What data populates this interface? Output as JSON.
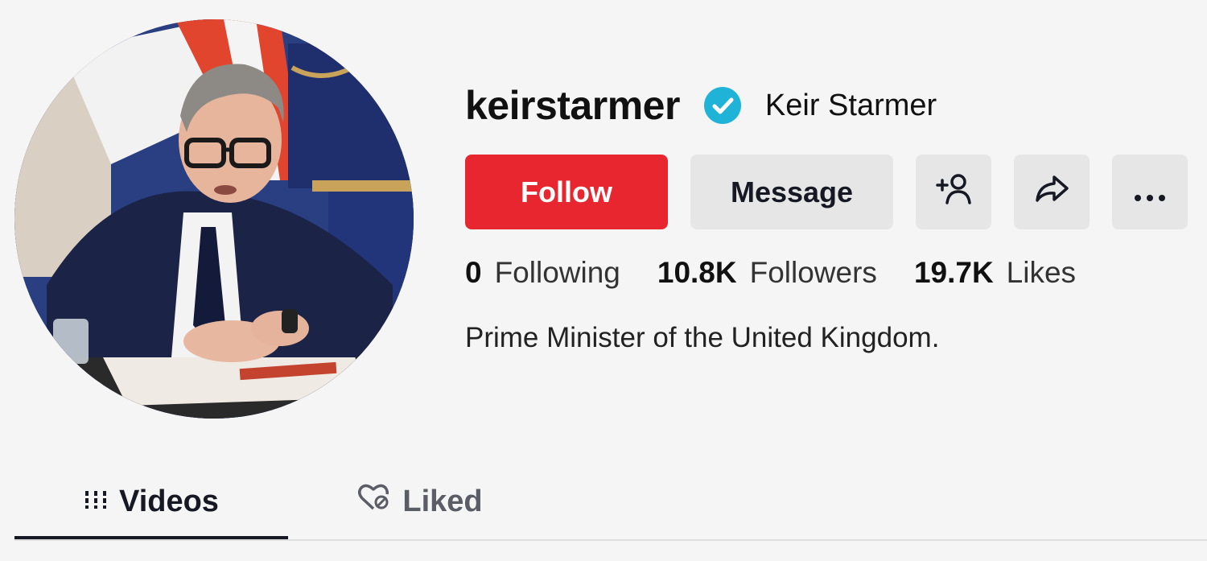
{
  "profile": {
    "username": "keirstarmer",
    "display_name": "Keir Starmer",
    "verified": true,
    "bio": "Prime Minister of the United Kingdom."
  },
  "actions": {
    "follow_label": "Follow",
    "message_label": "Message",
    "add_friend_icon": "add-person-icon",
    "share_icon": "share-arrow-icon",
    "more_icon": "more-dots-icon"
  },
  "stats": {
    "following": {
      "value": "0",
      "label": "Following"
    },
    "followers": {
      "value": "10.8K",
      "label": "Followers"
    },
    "likes": {
      "value": "19.7K",
      "label": "Likes"
    }
  },
  "tabs": [
    {
      "label": "Videos",
      "icon": "grid-icon",
      "active": true
    },
    {
      "label": "Liked",
      "icon": "heart-lock-icon",
      "active": false
    }
  ],
  "colors": {
    "follow_button": "#e8262f",
    "verified_badge": "#20b3d8",
    "secondary_button": "#e6e6e6",
    "background": "#f5f5f5"
  }
}
